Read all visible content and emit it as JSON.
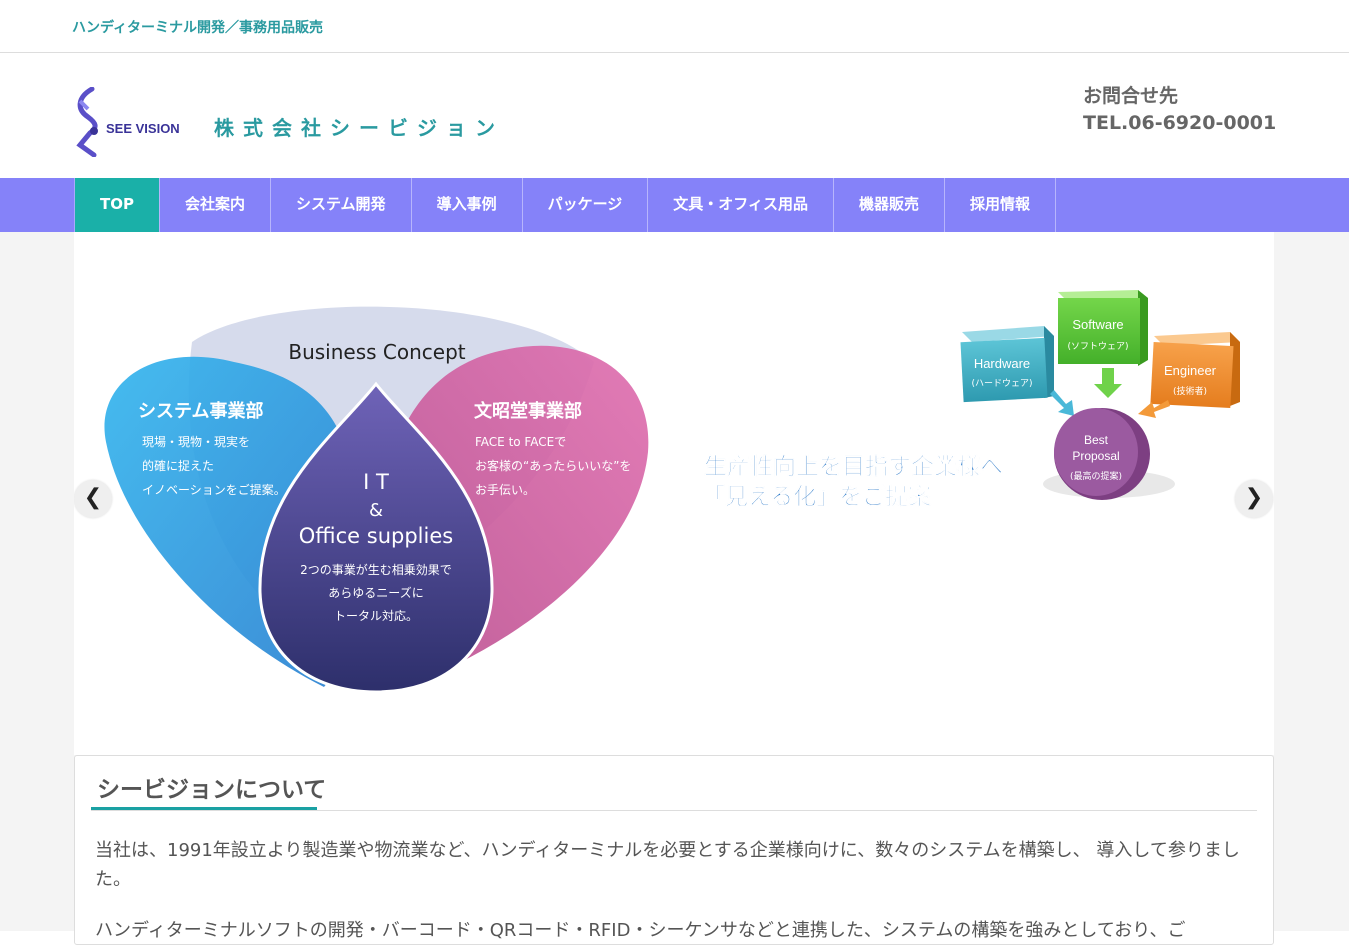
{
  "site": {
    "tagline": "ハンディターミナル開発／事務用品販売",
    "logo_text": "SEE VISION",
    "company_name": "株式会社シービジョン"
  },
  "contact": {
    "label": "お問合せ先",
    "tel": "TEL.06-6920-0001"
  },
  "nav": {
    "items": [
      {
        "label": "TOP",
        "active": true
      },
      {
        "label": "会社案内",
        "active": false
      },
      {
        "label": "システム開発",
        "active": false
      },
      {
        "label": "導入事例",
        "active": false
      },
      {
        "label": "パッケージ",
        "active": false
      },
      {
        "label": "文具・オフィス用品",
        "active": false
      },
      {
        "label": "機器販売",
        "active": false
      },
      {
        "label": "採用情報",
        "active": false
      }
    ]
  },
  "slider": {
    "prev_icon": "chevron-left-icon",
    "next_icon": "chevron-right-icon",
    "venn": {
      "title": "Business Concept",
      "left_heading": "システム事業部",
      "left_text": [
        "現場・現物・現実を",
        "的確に捉えた",
        "イノベーションをご提案。"
      ],
      "right_heading": "文昭堂事業部",
      "right_text": [
        "FACE to FACEで",
        "お客様の“あったらいいな”を",
        "お手伝い。"
      ],
      "center_title": [
        "I T",
        "&",
        "Office supplies"
      ],
      "center_text": [
        "2つの事業が生む相乗効果で",
        "あらゆるニーズに",
        "トータル対応。"
      ]
    },
    "diagram": {
      "hardware": "Hardware",
      "hardware_sub": "(ハードウェア)",
      "software": "Software",
      "software_sub": "(ソフトウェア)",
      "engineer": "Engineer",
      "engineer_sub": "(技術者)",
      "best": "Best",
      "proposal": "Proposal",
      "proposal_sub": "(最高の提案)",
      "headline1": "生産性向上を目指す企業様へ",
      "headline2": "「見える化」をご提案"
    }
  },
  "about": {
    "title": "シービジョンについて",
    "paragraph1": "当社は、1991年設立より製造業や物流業など、ハンディターミナルを必要とする企業様向けに、数々のシステムを構築し、 導入して参りました。",
    "paragraph2": "ハンディターミナルソフトの開発・バーコード・QRコード・RFID・シーケンサなどと連携した、システムの構築を強みとしており、ご"
  },
  "colors": {
    "nav": "#8582f9",
    "nav_active": "#1ab0a8",
    "accent": "#1aa1a3",
    "tagline": "#2a9aa0"
  }
}
